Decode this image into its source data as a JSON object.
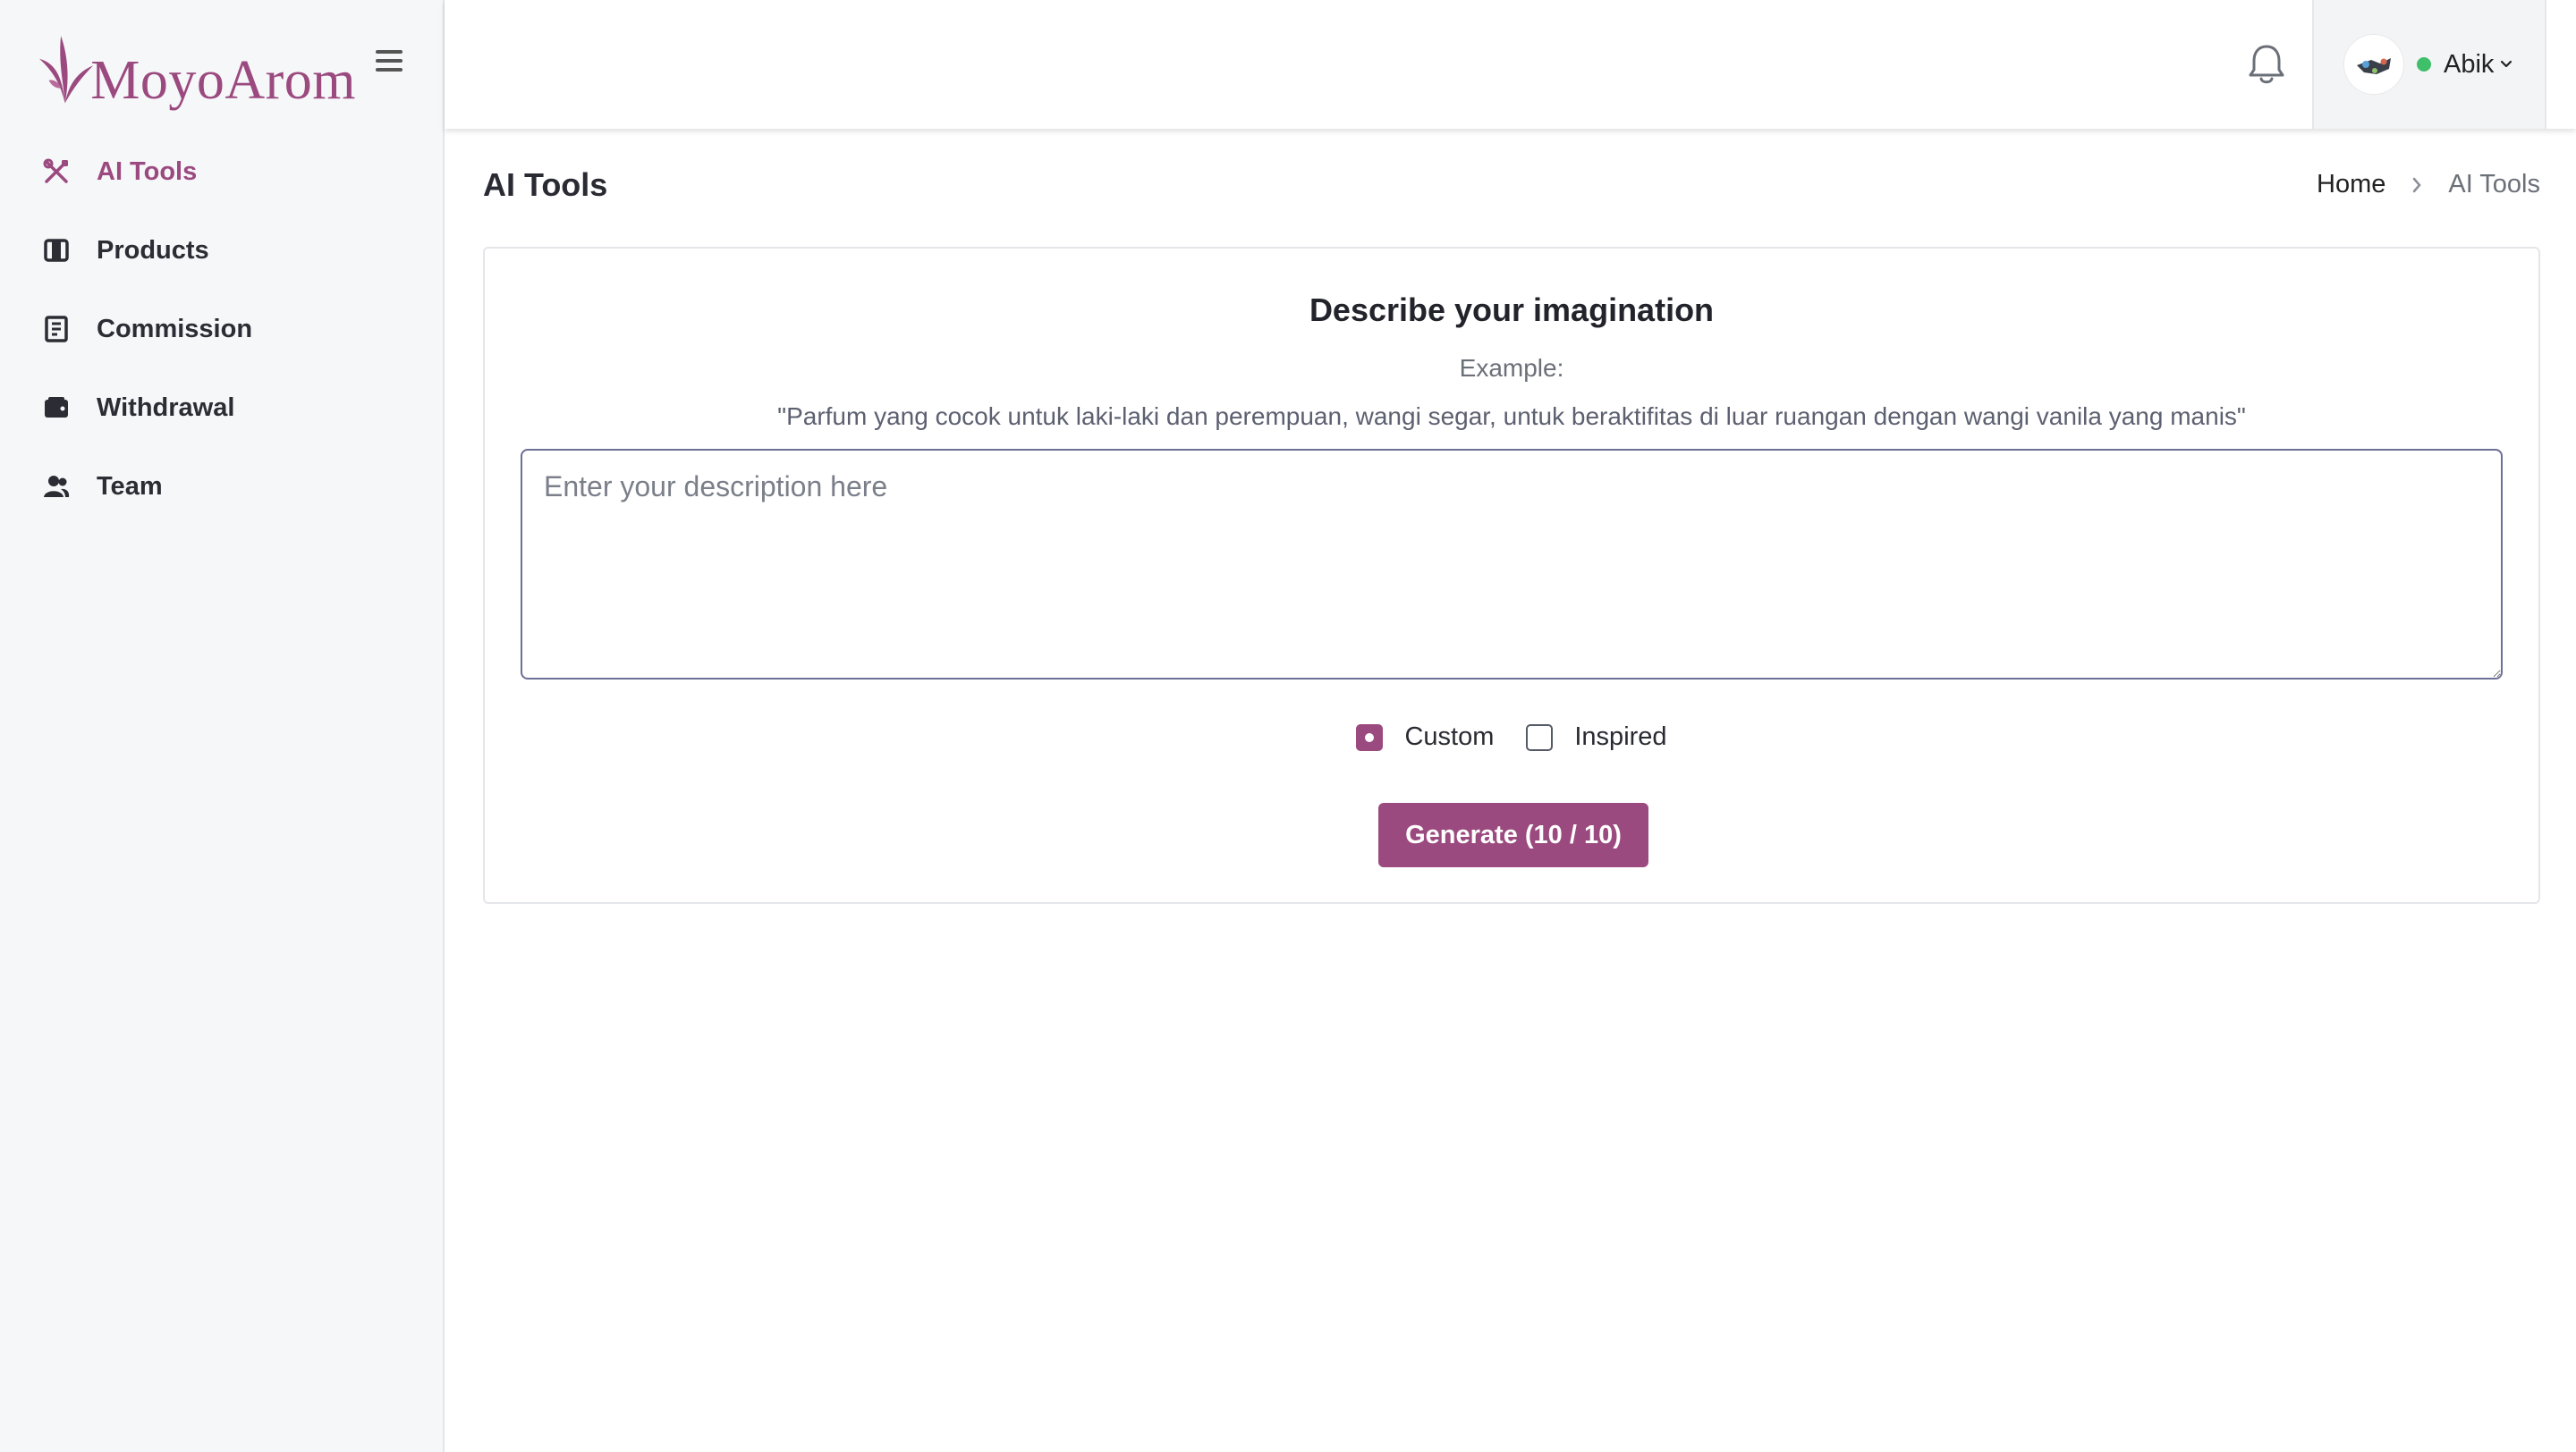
{
  "brand": {
    "name": "MoyoArom",
    "color": "#9b4a7f"
  },
  "sidebar": {
    "items": [
      {
        "label": "AI Tools",
        "icon": "tools-icon",
        "active": true
      },
      {
        "label": "Products",
        "icon": "products-icon",
        "active": false
      },
      {
        "label": "Commission",
        "icon": "commission-icon",
        "active": false
      },
      {
        "label": "Withdrawal",
        "icon": "wallet-icon",
        "active": false
      },
      {
        "label": "Team",
        "icon": "team-icon",
        "active": false
      }
    ]
  },
  "header": {
    "user": {
      "name": "Abik",
      "status": "online",
      "status_color": "#3fbf6a"
    },
    "icons": [
      "menu-icon",
      "bell-icon",
      "chevron-down-icon"
    ]
  },
  "page": {
    "title": "AI Tools",
    "breadcrumb": {
      "home": "Home",
      "current": "AI Tools"
    }
  },
  "card": {
    "title": "Describe your imagination",
    "example_label": "Example:",
    "example_text": "\"Parfum yang cocok untuk laki-laki dan perempuan, wangi segar, untuk beraktifitas di luar ruangan dengan wangi vanila yang manis\"",
    "input": {
      "placeholder": "Enter your description here",
      "value": ""
    },
    "options": [
      {
        "label": "Custom",
        "checked": true
      },
      {
        "label": "Inspired",
        "checked": false
      }
    ],
    "generate_label": "Generate (10 / 10)"
  },
  "colors": {
    "accent": "#9b4a7f",
    "sidebar_bg": "#f6f7f9"
  }
}
